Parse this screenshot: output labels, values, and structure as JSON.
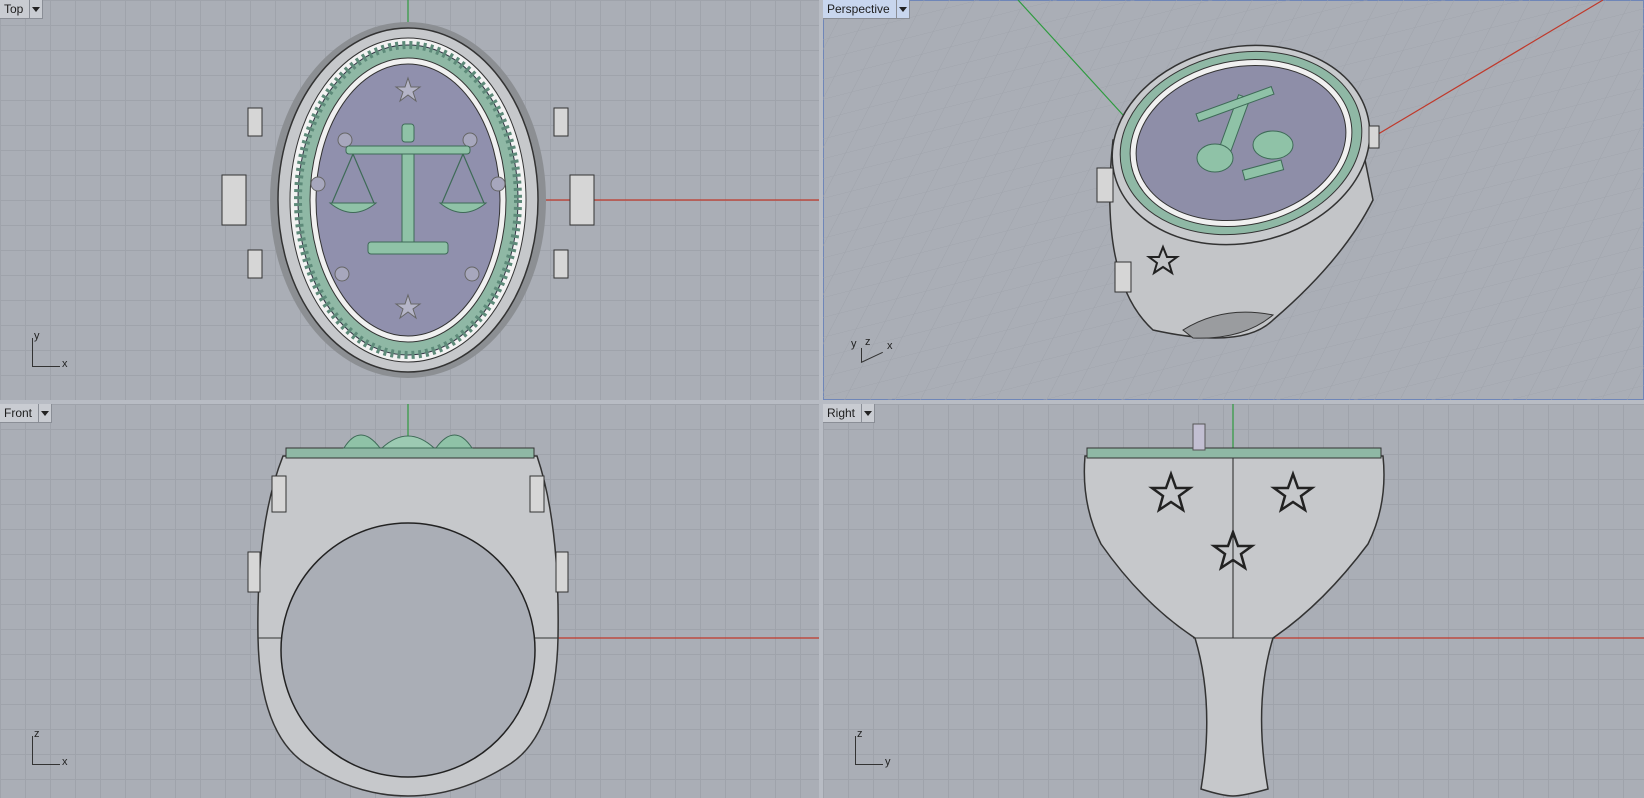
{
  "viewports": {
    "top": {
      "label": "Top",
      "axes": [
        "y",
        "x"
      ]
    },
    "persp": {
      "label": "Perspective",
      "axes": [
        "y",
        "z",
        "x"
      ]
    },
    "front": {
      "label": "Front",
      "axes": [
        "z",
        "x"
      ]
    },
    "right": {
      "label": "Right",
      "axes": [
        "z",
        "y"
      ]
    }
  },
  "colors": {
    "background": "#aaaeb6",
    "grid": "#9fa3ab",
    "x_axis": "#c0392b",
    "y_axis": "#2e9b3f",
    "metal": "#c7c9cc",
    "patina": "#8fb8a5",
    "stone": "#8e8ea8",
    "active_tab": "#c8d6ee"
  }
}
